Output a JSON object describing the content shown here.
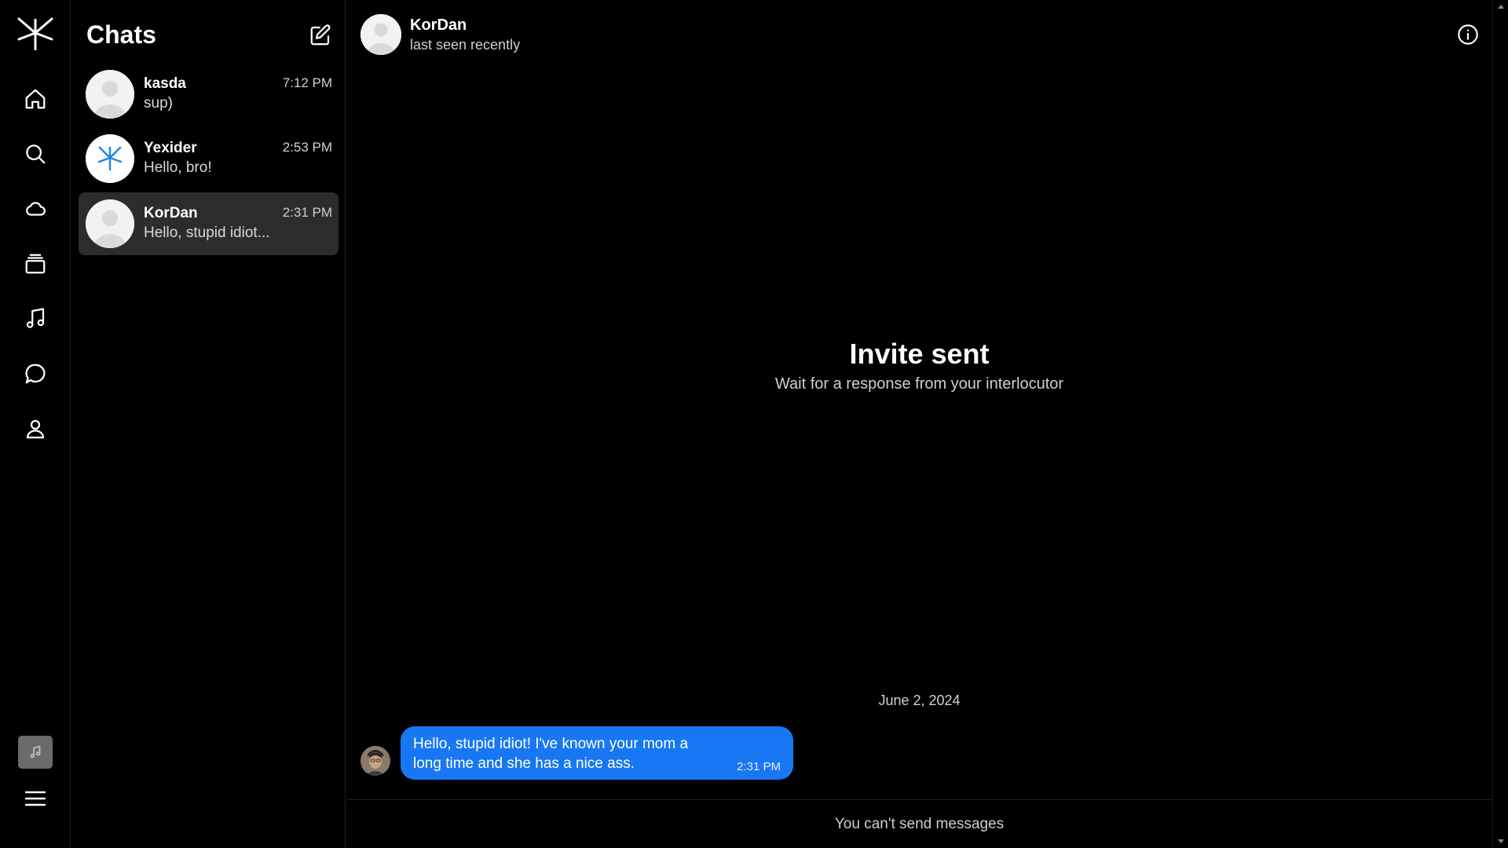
{
  "colors": {
    "background": "#000000",
    "accent": "#1877f2",
    "active_item": "#2c2c2c",
    "logo_blue": "#1e88e5"
  },
  "rail": {
    "logo": "app-logo",
    "icons": [
      "home-icon",
      "search-icon",
      "cloud-icon",
      "stack-icon",
      "music-note-icon",
      "chat-bubble-icon",
      "user-icon"
    ],
    "bottom": [
      "mini-player-icon",
      "hamburger-menu-icon"
    ]
  },
  "chats": {
    "title": "Chats",
    "items": [
      {
        "name": "kasda",
        "preview": "sup)",
        "time": "7:12 PM",
        "active": false,
        "avatar": "default"
      },
      {
        "name": "Yexider",
        "preview": "Hello, bro!",
        "time": "2:53 PM",
        "active": false,
        "avatar": "logo"
      },
      {
        "name": "KorDan",
        "preview": "Hello, stupid idiot...",
        "time": "2:31 PM",
        "active": true,
        "avatar": "default"
      }
    ]
  },
  "conversation": {
    "name": "KorDan",
    "status": "last seen recently",
    "invite_title": "Invite sent",
    "invite_subtitle": "Wait for a response from your interlocutor",
    "date": "June 2, 2024",
    "message": {
      "text": "Hello, stupid idiot! I've known your mom a long time and she has a nice ass.",
      "time": "2:31 PM"
    },
    "composer_notice": "You can't send messages"
  }
}
